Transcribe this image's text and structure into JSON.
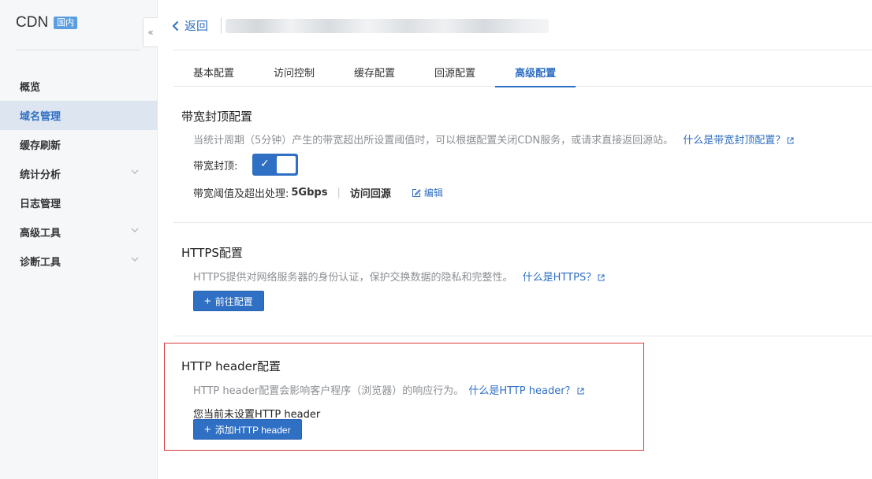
{
  "sidebar": {
    "brand_title": "CDN",
    "brand_badge": "国内",
    "collapse_glyph": "«",
    "items": [
      {
        "label": "概览",
        "has_submenu": false,
        "active": false
      },
      {
        "label": "域名管理",
        "has_submenu": false,
        "active": true
      },
      {
        "label": "缓存刷新",
        "has_submenu": false,
        "active": false
      },
      {
        "label": "统计分析",
        "has_submenu": true,
        "active": false
      },
      {
        "label": "日志管理",
        "has_submenu": false,
        "active": false
      },
      {
        "label": "高级工具",
        "has_submenu": true,
        "active": false
      },
      {
        "label": "诊断工具",
        "has_submenu": true,
        "active": false
      }
    ]
  },
  "header": {
    "back_label": "返回",
    "domain_title_blurred": true
  },
  "tabs": [
    {
      "label": "基本配置",
      "active": false
    },
    {
      "label": "访问控制",
      "active": false
    },
    {
      "label": "缓存配置",
      "active": false
    },
    {
      "label": "回源配置",
      "active": false
    },
    {
      "label": "高级配置",
      "active": true
    }
  ],
  "bandwidth": {
    "title": "带宽封顶配置",
    "desc": "当统计周期（5分钟）产生的带宽超出所设置阈值时，可以根据配置关闭CDN服务，或请求直接返回源站。",
    "help_link": "什么是带宽封顶配置？",
    "switch_label": "带宽封顶:",
    "switch_on": true,
    "threshold_label": "带宽阈值及超出处理:",
    "threshold_value": "5Gbps",
    "threshold_action": "访问回源",
    "edit_label": "编辑"
  },
  "https": {
    "title": "HTTPS配置",
    "desc": "HTTPS提供对网络服务器的身份认证，保护交换数据的隐私和完整性。",
    "help_link": "什么是HTTPS？",
    "button_label": "前往配置"
  },
  "http_header": {
    "title": "HTTP header配置",
    "desc": "HTTP header配置会影响客户程序（浏览器）的响应行为。",
    "help_link": "什么是HTTP header？",
    "empty_note": "您当前未设置HTTP header",
    "button_label": "添加HTTP header"
  },
  "colors": {
    "accent": "#2f6fc4",
    "sidebar_bg": "#f5f7f9",
    "active_nav_bg": "#dde5f0",
    "highlight_border": "#d9373e"
  },
  "icons": {
    "back": "chevron-left-icon",
    "collapse": "double-chevron-left-icon",
    "submenu": "chevron-down-icon",
    "external": "external-link-icon",
    "edit": "edit-icon",
    "check": "check-icon",
    "plus": "plus-icon"
  }
}
